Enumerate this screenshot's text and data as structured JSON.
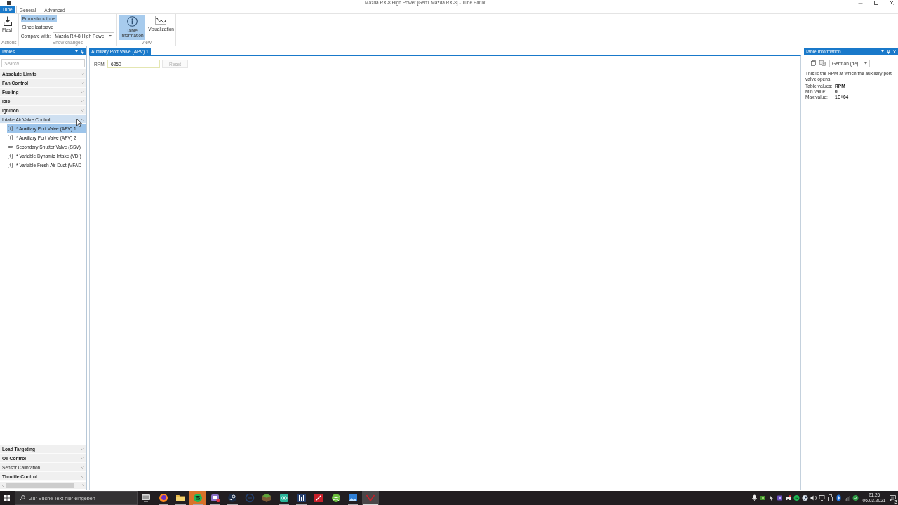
{
  "window": {
    "title": "Mazda RX-8 High Power [Gen1 Mazda RX-8] - Tune Editor"
  },
  "ribbon": {
    "tabs": [
      {
        "label": "Tune",
        "kind": "menu",
        "selected": false
      },
      {
        "label": "General",
        "kind": "tab",
        "selected": true
      },
      {
        "label": "Advanced",
        "kind": "tab",
        "selected": false
      }
    ],
    "groups": [
      {
        "label": "Actions",
        "items": [
          {
            "kind": "large",
            "label": "Flash",
            "selected": false
          }
        ]
      },
      {
        "label": "Show changes",
        "items": [
          {
            "kind": "option",
            "label": "From stock tune",
            "selected": true
          },
          {
            "kind": "option",
            "label": "Since last save",
            "selected": false
          },
          {
            "kind": "dropdown",
            "label": "Compare with:",
            "value": "Mazda RX-8 High Powe"
          }
        ]
      },
      {
        "label": "View",
        "items": [
          {
            "kind": "large",
            "label": "Table Information",
            "selected": true
          },
          {
            "kind": "large",
            "label": "Visualization",
            "selected": false
          }
        ]
      }
    ]
  },
  "tables_panel": {
    "title": "Tables",
    "search": {
      "placeholder": "Search..."
    },
    "categories": [
      {
        "label": "Absolute Limits",
        "bold": true,
        "expanded": false
      },
      {
        "label": "Fan Control",
        "bold": true,
        "expanded": false
      },
      {
        "label": "Fueling",
        "bold": true,
        "expanded": false
      },
      {
        "label": "Idle",
        "bold": true,
        "expanded": false
      },
      {
        "label": "Ignition",
        "bold": true,
        "expanded": false
      },
      {
        "label": "Intake Air Valve Control",
        "bold": false,
        "expanded": true,
        "children": [
          {
            "label": "* Auxiliary Port Valve (APV) 1",
            "kind": "table",
            "selected": true
          },
          {
            "label": "* Auxiliary Port Valve (APV) 2",
            "kind": "table",
            "selected": false
          },
          {
            "label": "Secondary Shutter Valve (SSV)",
            "kind": "flag",
            "selected": false
          },
          {
            "label": "* Variable Dynamic Intake (VDI)",
            "kind": "table",
            "selected": false
          },
          {
            "label": "* Variable Fresh Air Duct (VFAD",
            "kind": "table",
            "selected": false
          }
        ]
      },
      {
        "label": "Load Targeting",
        "bold": true,
        "expanded": false
      },
      {
        "label": "Oil Control",
        "bold": true,
        "expanded": false
      },
      {
        "label": "Sensor Calibration",
        "bold": false,
        "expanded": false
      },
      {
        "label": "Throttle Control",
        "bold": true,
        "expanded": false
      }
    ]
  },
  "document": {
    "tabs": [
      {
        "label": "Auxiliary Port Valve (APV) 1",
        "selected": true
      }
    ],
    "field": {
      "label": "RPM:",
      "value": "6250"
    },
    "reset_button": {
      "label": "Reset",
      "disabled": true
    }
  },
  "info_panel": {
    "title": "Table Information",
    "language": "German (de)",
    "description": "This is the RPM at which the auxiliary port valve opens.",
    "properties": [
      {
        "label": "Table values:",
        "value": "RPM"
      },
      {
        "label": "Min value:",
        "value": "0"
      },
      {
        "label": "Max value:",
        "value": "1E+04"
      }
    ]
  },
  "taskbar": {
    "search": {
      "placeholder": "Zur Suche Text hier eingeben"
    },
    "apps": [
      {
        "selected": false,
        "attention": false,
        "running": false
      },
      {
        "selected": false,
        "attention": false,
        "running": true
      },
      {
        "selected": false,
        "attention": false,
        "running": true
      },
      {
        "selected": false,
        "attention": true,
        "running": true
      },
      {
        "selected": false,
        "attention": false,
        "running": true
      },
      {
        "selected": false,
        "attention": false,
        "running": true
      },
      {
        "selected": false,
        "attention": false,
        "running": false
      },
      {
        "selected": false,
        "attention": false,
        "running": false
      },
      {
        "selected": false,
        "attention": false,
        "running": true
      },
      {
        "selected": false,
        "attention": false,
        "running": true
      },
      {
        "selected": false,
        "attention": false,
        "running": false
      },
      {
        "selected": false,
        "attention": false,
        "running": false
      },
      {
        "selected": false,
        "attention": false,
        "running": true
      },
      {
        "selected": true,
        "attention": false,
        "running": true
      }
    ],
    "clock": {
      "time": "21:26",
      "date": "06.03.2021"
    },
    "notifications": "3"
  }
}
